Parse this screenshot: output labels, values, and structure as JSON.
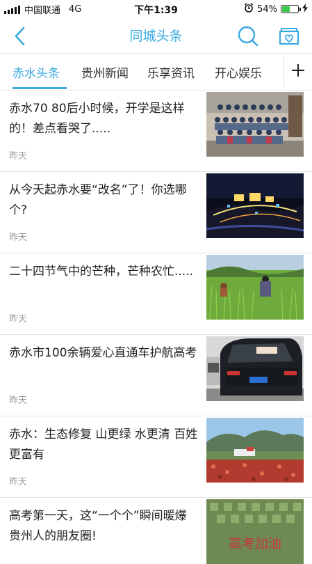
{
  "status_bar": {
    "carrier": "中国联通",
    "network": "4G",
    "time": "下午1:39",
    "battery": "54%",
    "battery_level": 0.54
  },
  "header": {
    "title": "同城头条",
    "back_icon": "chevron-left-icon",
    "search_icon": "search-icon",
    "favorites_icon": "heart-folder-icon"
  },
  "tabs": [
    {
      "label": "赤水头条",
      "active": true
    },
    {
      "label": "贵州新闻",
      "active": false
    },
    {
      "label": "乐享资讯",
      "active": false
    },
    {
      "label": "开心娱乐",
      "active": false
    }
  ],
  "colors": {
    "accent": "#3aa9e0",
    "muted": "#999999"
  },
  "feed": [
    {
      "title": "赤水70 80后小时候，开学是这样的！差点看哭了.....",
      "time": "昨天"
    },
    {
      "title": "从今天起赤水要“改名”了！你选哪个?",
      "time": "昨天"
    },
    {
      "title": "二十四节气中的芒种，芒种农忙.....",
      "time": "昨天"
    },
    {
      "title": "赤水市100余辆爱心直通车护航高考",
      "time": "昨天"
    },
    {
      "title": "赤水：生态修复 山更绿 水更清 百姓更富有",
      "time": "昨天"
    },
    {
      "title": "高考第一天，这“一个个”瞬间暖爆贵州人的朋友圈!",
      "time": ""
    }
  ],
  "thumb_banner_text": "高考加油"
}
